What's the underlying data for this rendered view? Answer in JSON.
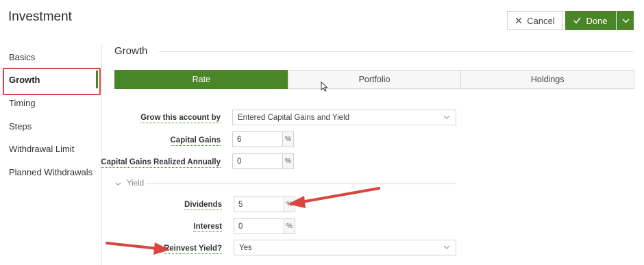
{
  "header": {
    "title": "Investment",
    "cancel_label": "Cancel",
    "done_label": "Done"
  },
  "sidebar": {
    "items": [
      {
        "label": "Basics"
      },
      {
        "label": "Growth"
      },
      {
        "label": "Timing"
      },
      {
        "label": "Steps"
      },
      {
        "label": "Withdrawal Limit"
      },
      {
        "label": "Planned Withdrawals"
      }
    ],
    "active": "Growth"
  },
  "section": {
    "title": "Growth"
  },
  "tabs": [
    {
      "label": "Rate"
    },
    {
      "label": "Portfolio"
    },
    {
      "label": "Holdings"
    }
  ],
  "form": {
    "grow_by": {
      "label": "Grow this account by",
      "value": "Entered Capital Gains and Yield"
    },
    "capital_gains": {
      "label": "Capital Gains",
      "value": "6",
      "unit": "%"
    },
    "cg_realized": {
      "label": "Capital Gains Realized Annually",
      "value": "0",
      "unit": "%"
    },
    "yield_section": {
      "label": "Yield"
    },
    "dividends": {
      "label": "Dividends",
      "value": "5",
      "unit": "%"
    },
    "interest": {
      "label": "Interest",
      "value": "0",
      "unit": "%"
    },
    "reinvest": {
      "label": "Reinvest Yield?",
      "value": "Yes"
    }
  },
  "colors": {
    "accent": "#4a8627",
    "annotation": "#d9453f"
  },
  "icons": {
    "cancel": "close-icon",
    "done": "check-icon",
    "done_menu": "chevron-down-icon",
    "select": "chevron-down-icon",
    "yield_toggle": "chevron-down-icon"
  }
}
